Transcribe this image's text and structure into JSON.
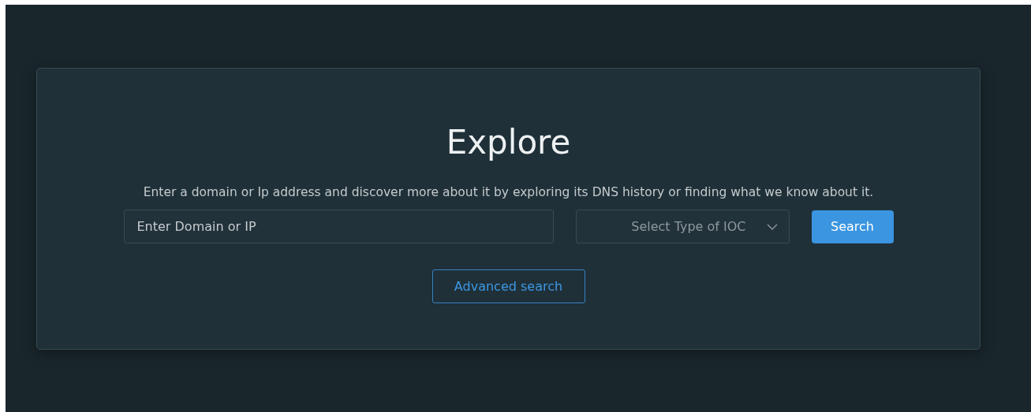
{
  "card": {
    "title": "Explore",
    "description": "Enter a domain or Ip address and discover more about it by exploring its DNS history or finding what we know about it.",
    "search": {
      "placeholder": "Enter Domain or IP"
    },
    "ioc_select": {
      "label": "Select Type of IOC"
    },
    "search_button": "Search",
    "advanced_button": "Advanced search"
  }
}
